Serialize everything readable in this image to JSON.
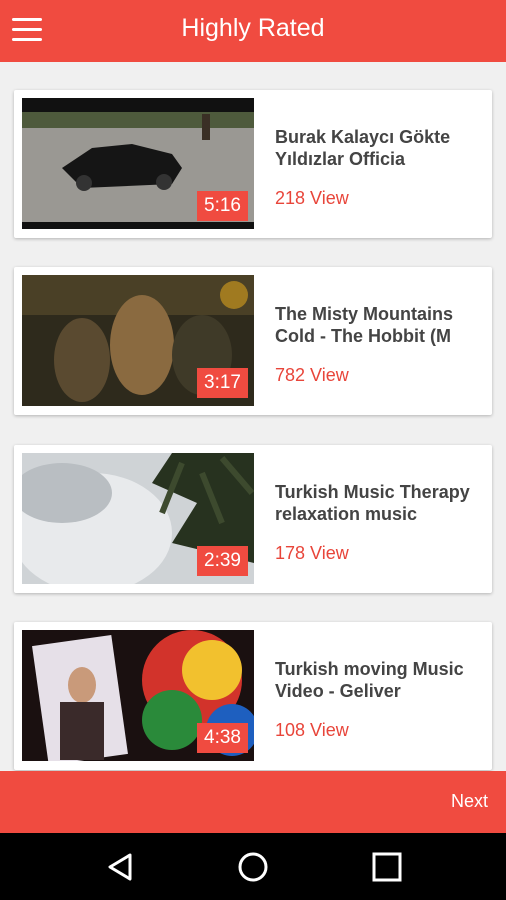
{
  "appbar": {
    "title": "Highly Rated",
    "menu_icon": "hamburger-menu-icon"
  },
  "videos": [
    {
      "title_line1": "Burak Kalaycı Gökte",
      "title_line2": "Yıldızlar Officia",
      "duration": "5:16",
      "views": "218 View"
    },
    {
      "title_line1": "The Misty Mountains",
      "title_line2": "Cold - The Hobbit (M",
      "duration": "3:17",
      "views": "782 View"
    },
    {
      "title_line1": "Turkish Music Therapy",
      "title_line2": "relaxation music",
      "duration": "2:39",
      "views": "178 View"
    },
    {
      "title_line1": "Turkish moving Music",
      "title_line2": "Video - Geliver",
      "duration": "4:38",
      "views": "108 View"
    }
  ],
  "footer": {
    "next_label": "Next"
  },
  "navbar": {
    "back_icon": "back-triangle-icon",
    "home_icon": "home-circle-icon",
    "recents_icon": "recents-square-icon"
  },
  "colors": {
    "accent": "#f04b40",
    "views_text": "#e8453a",
    "background": "#f0f0f0"
  }
}
